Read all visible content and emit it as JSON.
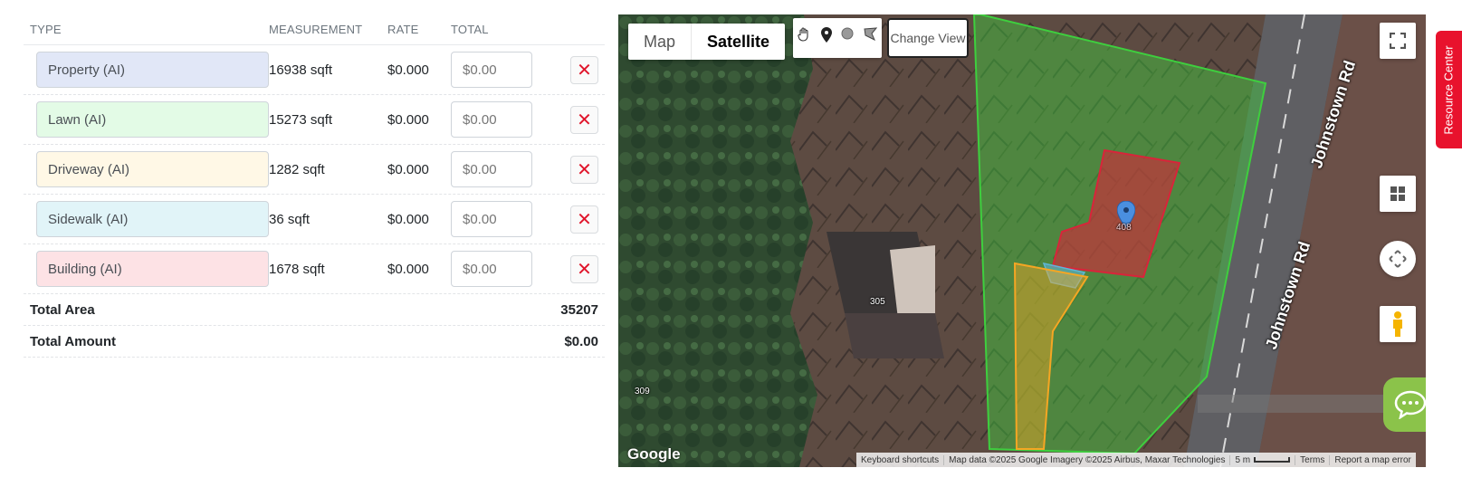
{
  "table": {
    "headers": {
      "type": "TYPE",
      "measurement": "MEASUREMENT",
      "rate": "RATE",
      "total": "TOTAL"
    },
    "rows": [
      {
        "type": "Property (AI)",
        "measurement": "16938 sqft",
        "rate": "$0.000",
        "total_placeholder": "$0.00",
        "style": "property"
      },
      {
        "type": "Lawn (AI)",
        "measurement": "15273 sqft",
        "rate": "$0.000",
        "total_placeholder": "$0.00",
        "style": "lawn"
      },
      {
        "type": "Driveway (AI)",
        "measurement": "1282 sqft",
        "rate": "$0.000",
        "total_placeholder": "$0.00",
        "style": "driveway"
      },
      {
        "type": "Sidewalk (AI)",
        "measurement": "36 sqft",
        "rate": "$0.000",
        "total_placeholder": "$0.00",
        "style": "sidewalk"
      },
      {
        "type": "Building (AI)",
        "measurement": "1678 sqft",
        "rate": "$0.000",
        "total_placeholder": "$0.00",
        "style": "building"
      }
    ],
    "delete_glyph": "✕",
    "total_area": {
      "label": "Total Area",
      "value": "35207"
    },
    "total_amount": {
      "label": "Total Amount",
      "value": "$0.00"
    }
  },
  "map": {
    "type_control": {
      "map": "Map",
      "satellite": "Satellite",
      "selected": "Satellite"
    },
    "tools": [
      "hand-icon",
      "marker-icon",
      "circle-icon",
      "polygon-icon"
    ],
    "change_view": "Change View",
    "house_numbers": {
      "a": "305",
      "b": "309",
      "c": "408"
    },
    "road_label_top": "Johnstown Rd",
    "road_label_bottom": "Johnstown Rd",
    "google": "Google",
    "attribution": {
      "shortcuts": "Keyboard shortcuts",
      "data": "Map data ©2025 Google Imagery ©2025 Airbus, Maxar Technologies",
      "scale": "5 m",
      "terms": "Terms",
      "report": "Report a map error"
    },
    "overlay_colors": {
      "property": "#3ecf3e",
      "building": "#d9243a",
      "driveway": "#f5a623",
      "sidewalk": "#5fb6d6"
    }
  },
  "resource_center": "Resource Center"
}
